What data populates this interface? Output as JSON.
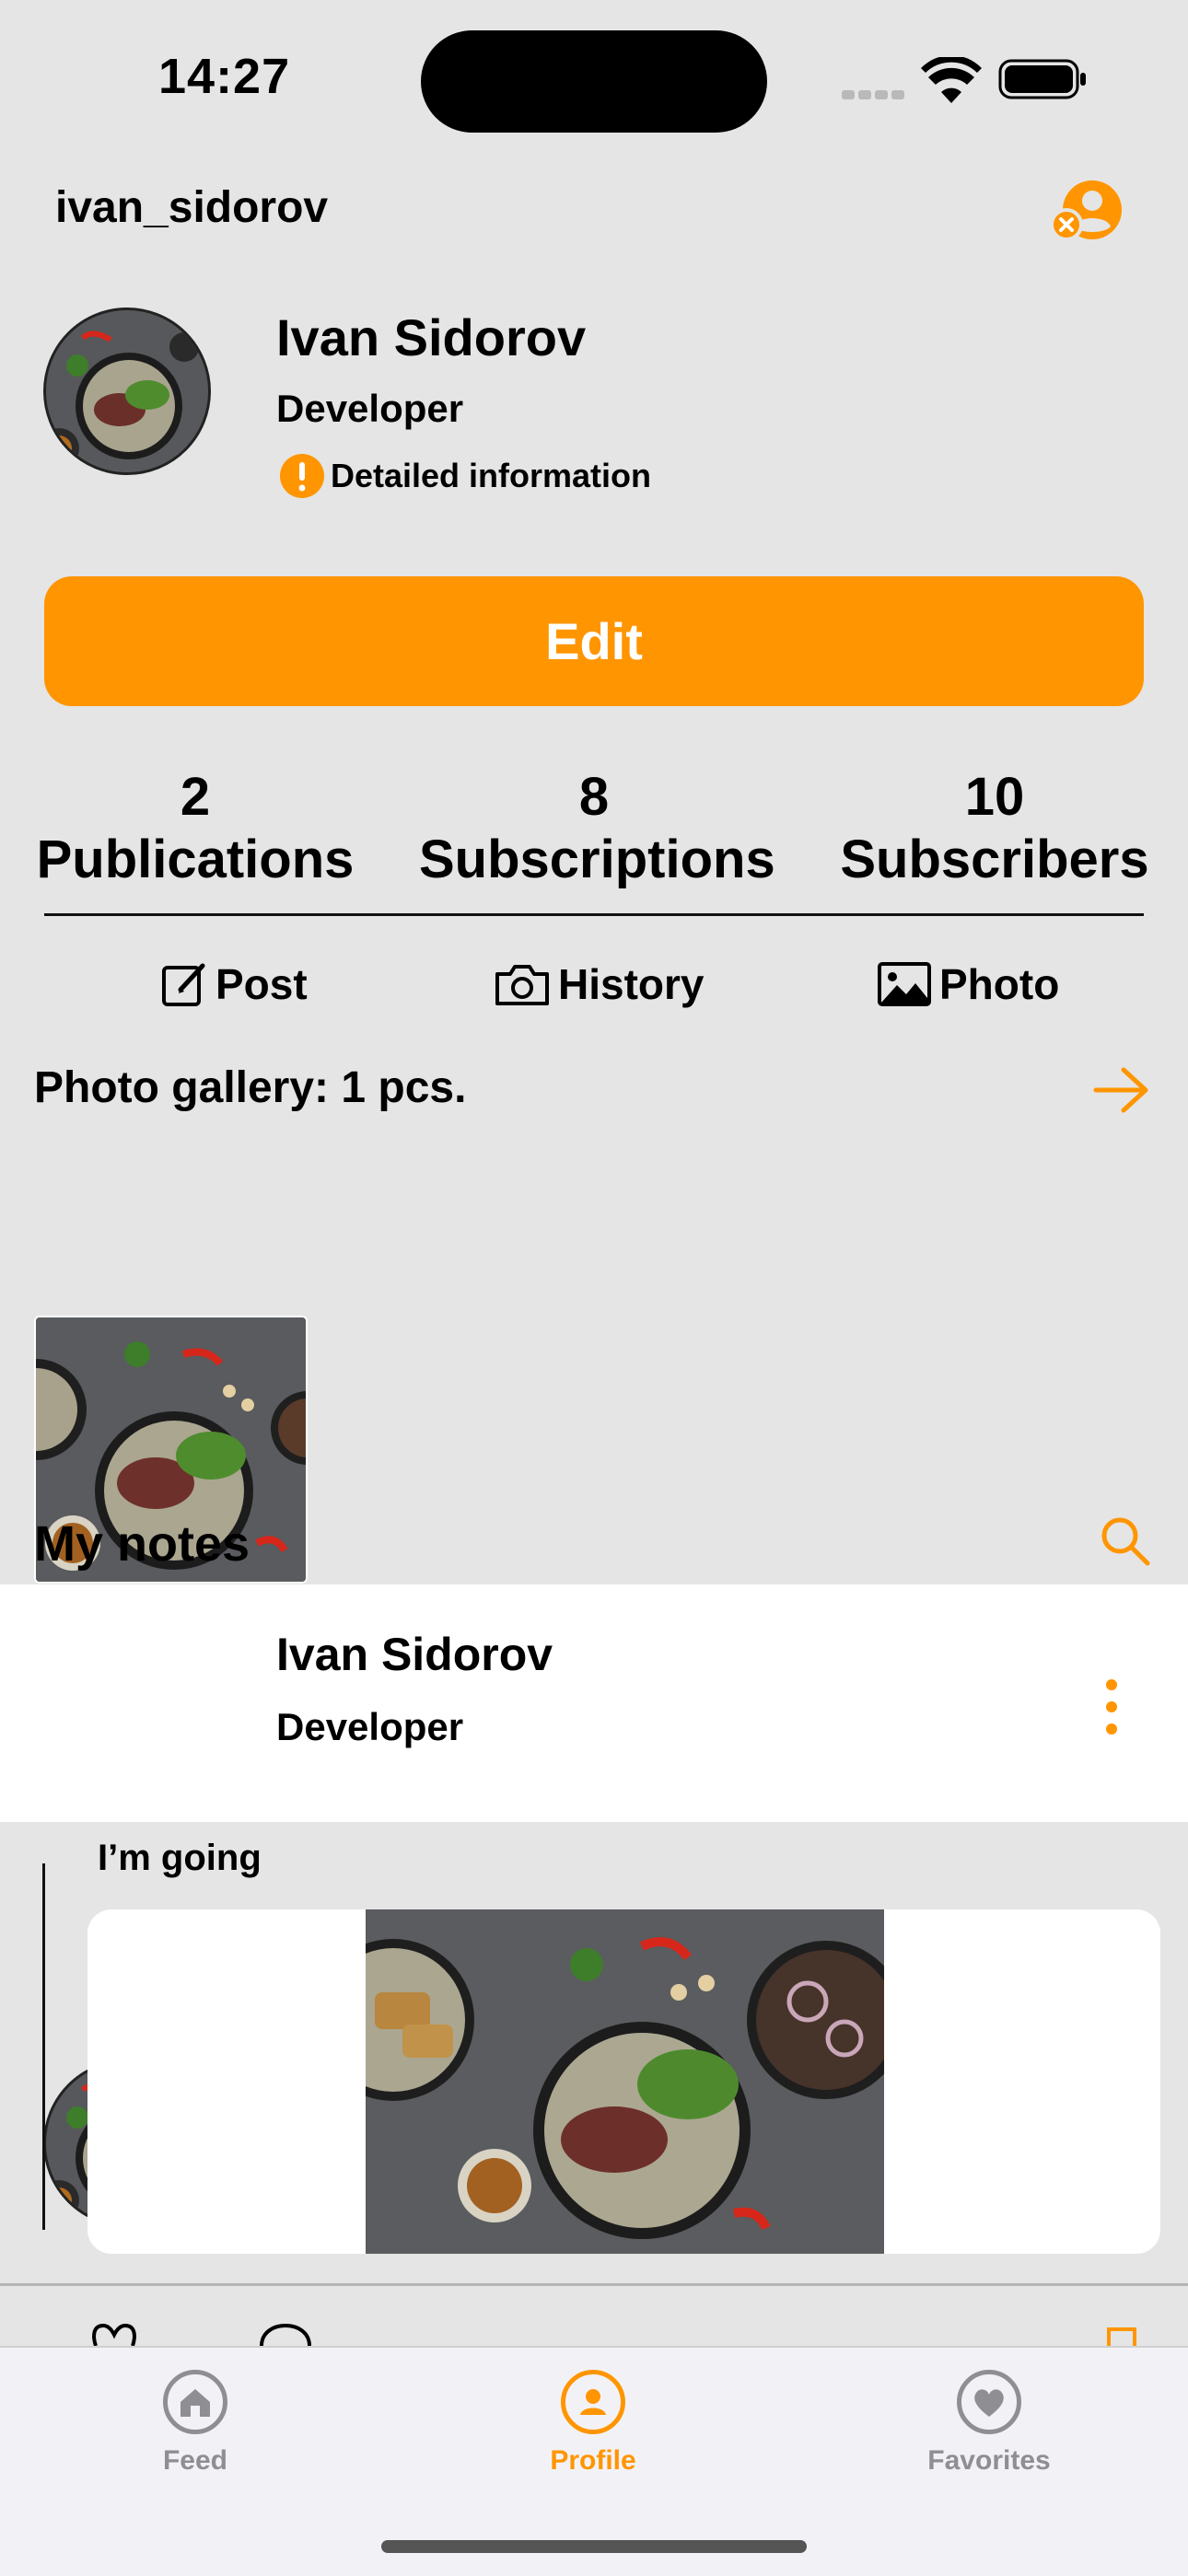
{
  "status_bar": {
    "time": "14:27"
  },
  "header": {
    "username": "ivan_sidorov"
  },
  "profile": {
    "name": "Ivan Sidorov",
    "role": "Developer",
    "details_link": "Detailed information"
  },
  "edit_button": "Edit",
  "stats": [
    {
      "value": "2",
      "label": "Publications"
    },
    {
      "value": "8",
      "label": "Subscriptions"
    },
    {
      "value": "10",
      "label": "Subscribers"
    }
  ],
  "content_tabs": {
    "post": "Post",
    "history": "History",
    "photo": "Photo"
  },
  "gallery": {
    "title": "Photo gallery: 1 pcs."
  },
  "notes": {
    "title": "My notes",
    "author": "Ivan Sidorov",
    "author_role": "Developer",
    "text": "I’m going"
  },
  "tab_bar": {
    "feed": "Feed",
    "profile": "Profile",
    "favorites": "Favorites"
  },
  "colors": {
    "accent": "#ff9500",
    "background": "#e5e5e5",
    "inactive": "#8e8e93"
  },
  "icons": {
    "subscriptions": "person-x-icon",
    "details": "exclamation-icon",
    "gallery_more": "arrow-right-icon",
    "notes_search": "search-icon",
    "note_menu": "ellipsis-vertical-icon"
  }
}
